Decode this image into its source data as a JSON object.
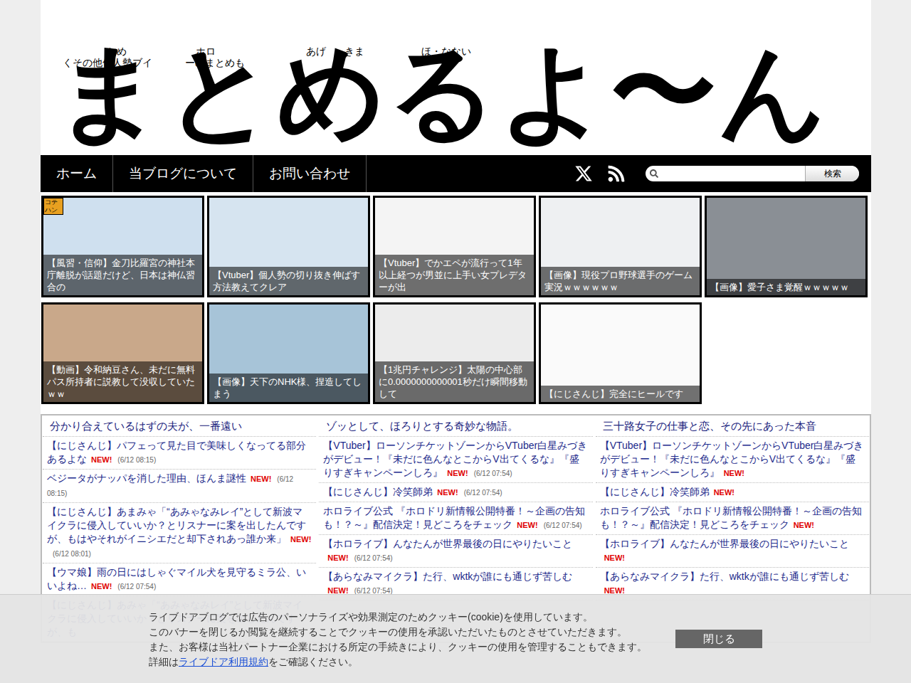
{
  "header": {
    "tagline": [
      {
        "text": "とめ",
        "line": 1
      },
      {
        "text": "ホロ",
        "line": 1
      },
      {
        "text": "あげ",
        "line": 1
      },
      {
        "text": "きま",
        "line": 1
      },
      {
        "text": "ほ・なない",
        "line": 1
      },
      {
        "text": "くその他個人勢ブイ",
        "line": 2
      },
      {
        "text": "ーのまとめも",
        "line": 2
      }
    ],
    "logo": "まとめるよ〜ん"
  },
  "nav": {
    "items": [
      {
        "label": "ホーム"
      },
      {
        "label": "当ブログについて"
      },
      {
        "label": "お問い合わせ"
      }
    ],
    "search_button": "検索",
    "search_value": ""
  },
  "cards": [
    {
      "caption": "【風習・信仰】金刀比羅宮の神社本庁離脱が話題だけど、日本は神仏習合の",
      "badge": "コテハン"
    },
    {
      "caption": "【Vtuber】個人勢の切り抜き伸ばす方法教えてクレア"
    },
    {
      "caption": "【Vtuber】でかエペが流行って1年以上経つが男並に上手い女プレデターが出"
    },
    {
      "caption": "【画像】現役プロ野球選手のゲーム実況ｗｗｗｗｗｗ"
    },
    {
      "caption": "【画像】愛子さま覚醒ｗｗｗｗｗ"
    },
    {
      "caption": "【動画】令和納豆さん、未だに無料パス所持者に説教して没収していたｗｗ"
    },
    {
      "caption": "【画像】天下のNHK様、捏造してしまう"
    },
    {
      "caption": "【1兆円チャレンジ】太陽の中心部に0.0000000000001秒だけ瞬間移動して"
    },
    {
      "caption": "【にじさんじ】完全にヒールです"
    }
  ],
  "columns": [
    {
      "header": "分かり合えているはずの夫が、一番遠い",
      "items": [
        {
          "text": "【にじさんじ】パフェって見た目で美味しくなってる部分あるよな",
          "new": "NEW!",
          "date": "(6/12 08:15)"
        },
        {
          "text": "ベジータがナッパを消した理由、ほんま謎性",
          "new": "NEW!",
          "date": "(6/12 08:15)"
        },
        {
          "text": "【にじさんじ】あまみゃ「“あみゃなみレイ”として新波マイクラに侵入していいか？とリスナーに案を出したんですが、もはやそれがイニシエだと却下されあっ誰か来」",
          "new": "NEW!",
          "date": "(6/12 08:01)"
        },
        {
          "text": "【ウマ娘】雨の日にはしゃぐマイル犬を見守るミラ公、いいよね…",
          "new": "NEW!",
          "date": "(6/12 07:54)"
        },
        {
          "text": "【にじさんじ】あみゃ「“あみゃなみレイ”として新波マイクラに侵入していいか？とリスナーに案を出したんですが、も"
        }
      ]
    },
    {
      "header": "ゾッとして、ほろりとする奇妙な物語。",
      "items": [
        {
          "text": "【VTuber】ローソンチケットゾーンからVTuber白星みづきがデビュー！『未だに色んなとこからV出てくるな』『盛りすぎキャンペーンしろ』",
          "new": "NEW!",
          "date": "(6/12 07:54)"
        },
        {
          "text": "【にじさんじ】冷笑師弟",
          "new": "NEW!",
          "date": "(6/12 07:54)"
        },
        {
          "text": "ホロライブ公式 『ホロドリ新情報公開特番！～企画の告知も！？～』配信決定！見どころをチェック",
          "new": "NEW!",
          "date": "(6/12 07:54)"
        },
        {
          "text": "【ホロライブ】んなたんが世界最後の日にやりたいこと",
          "new": "NEW!",
          "date": "(6/12 07:54)"
        },
        {
          "text": "【あらなみマイクラ】た行、wktkが誰にも通じず苦しむ",
          "new": "NEW!",
          "date": "(6/12 07:54)"
        }
      ]
    },
    {
      "header": "三十路女子の仕事と恋、その先にあった本音",
      "items": [
        {
          "text": "【VTuber】ローソンチケットゾーンからVTuber白星みづきがデビュー！『未だに色んなとこからV出てくるな』『盛りすぎキャンペーンしろ』",
          "new": "NEW!"
        },
        {
          "text": "【にじさんじ】冷笑師弟",
          "new": "NEW!"
        },
        {
          "text": "ホロライブ公式 『ホロドリ新情報公開特番！～企画の告知も！？～』配信決定！見どころをチェック",
          "new": "NEW!"
        },
        {
          "text": "【ホロライブ】んなたんが世界最後の日にやりたいこと",
          "new": "NEW!"
        },
        {
          "text": "【あらなみマイクラ】た行、wktkが誰にも通じず苦しむ",
          "new": "NEW!"
        }
      ]
    }
  ],
  "cookie_banner": {
    "lines": [
      "ライブドアブログでは広告のパーソナライズや効果測定のためクッキー(cookie)を使用しています。",
      "このバナーを閉じるか閲覧を継続することでクッキーの使用を承認いただいたものとさせていただきます。",
      "また、お客様は当社パートナー企業における所定の手続きにより、クッキーの使用を管理することもできます。"
    ],
    "last_prefix": "詳細は",
    "link": "ライブドア利用規約",
    "last_suffix": "をご確認ください。",
    "button": "閉じる"
  }
}
